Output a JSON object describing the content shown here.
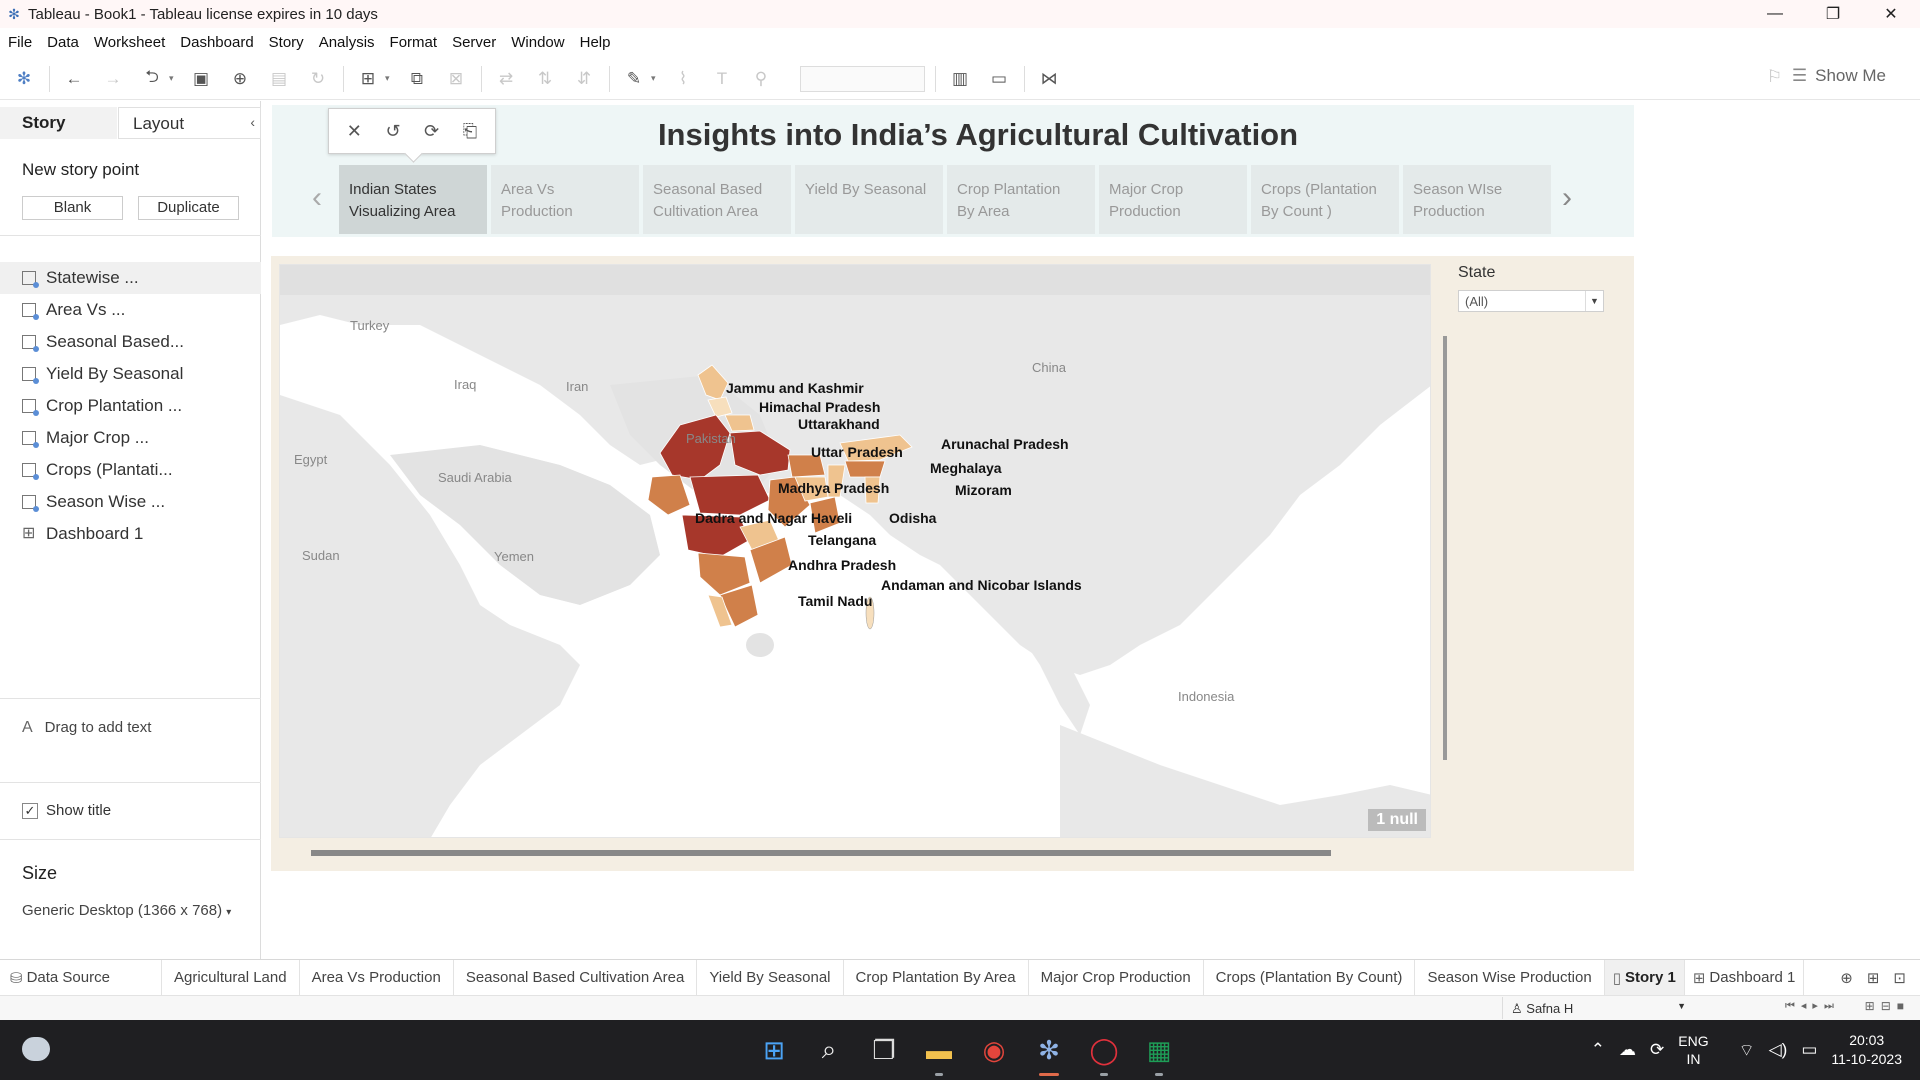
{
  "window": {
    "title": "Tableau - Book1 - Tableau license expires in 10 days",
    "minimize": "—",
    "restore": "❐",
    "close": "✕"
  },
  "menu": [
    "File",
    "Data",
    "Worksheet",
    "Dashboard",
    "Story",
    "Analysis",
    "Format",
    "Server",
    "Window",
    "Help"
  ],
  "toolbar": {
    "show_me": "Show Me"
  },
  "left_panel": {
    "tab_story": "Story",
    "tab_layout": "Layout",
    "new_story_point": "New story point",
    "blank": "Blank",
    "duplicate": "Duplicate",
    "sheets": [
      {
        "label": "Statewise ...",
        "kind": "sheet"
      },
      {
        "label": "Area Vs ...",
        "kind": "sheet"
      },
      {
        "label": "Seasonal Based...",
        "kind": "sheet"
      },
      {
        "label": "Yield By Seasonal",
        "kind": "sheet"
      },
      {
        "label": "Crop Plantation ...",
        "kind": "sheet"
      },
      {
        "label": "Major Crop ...",
        "kind": "sheet"
      },
      {
        "label": "Crops (Plantati...",
        "kind": "sheet"
      },
      {
        "label": "Season Wise ...",
        "kind": "sheet"
      },
      {
        "label": "Dashboard 1",
        "kind": "dashboard"
      }
    ],
    "drag_text": "Drag to add text",
    "show_title": "Show title",
    "size_label": "Size",
    "size_value": "Generic Desktop (1366 x 768)"
  },
  "story": {
    "title": "Insights into India’s Agricultural Cultivation",
    "points": [
      {
        "line1": "Indian States",
        "line2": "Visualizing Area",
        "active": true
      },
      {
        "line1": "Area Vs",
        "line2": "Production",
        "active": false
      },
      {
        "line1": "Seasonal Based",
        "line2": "Cultivation Area",
        "active": false
      },
      {
        "line1": "Yield By Seasonal",
        "line2": "",
        "active": false
      },
      {
        "line1": "Crop Plantation",
        "line2": "By Area",
        "active": false
      },
      {
        "line1": "Major Crop",
        "line2": "Production",
        "active": false
      },
      {
        "line1": "Crops (Plantation",
        "line2": "By Count )",
        "active": false
      },
      {
        "line1": "Season WIse",
        "line2": "Production",
        "active": false
      }
    ]
  },
  "map": {
    "countries": [
      "Turkey",
      "Iraq",
      "Iran",
      "Egypt",
      "Saudi Arabia",
      "Sudan",
      "Yemen",
      "Pakistan",
      "China",
      "Indonesia"
    ],
    "states": [
      "Jammu and Kashmir",
      "Himachal Pradesh",
      "Uttarakhand",
      "Uttar Pradesh",
      "Arunachal Pradesh",
      "Meghalaya",
      "Madhya Pradesh",
      "Mizoram",
      "Dadra and Nagar Haveli",
      "Odisha",
      "Telangana",
      "Andhra Pradesh",
      "Andaman and Nicobar Islands",
      "Tamil Nadu"
    ],
    "null_badge": "1 null",
    "colors": {
      "high": "#a7372b",
      "mid": "#d0804a",
      "low": "#efc38f",
      "lowest": "#f7dfbd",
      "land": "#e6e6e6",
      "water": "#ffffff"
    }
  },
  "filter": {
    "label": "State",
    "value": "(All)"
  },
  "sheet_tabs": [
    "Data Source",
    "Agricultural Land",
    "Area Vs Production",
    "Seasonal Based Cultivation Area",
    "Yield By Seasonal",
    "Crop Plantation By Area",
    "Major Crop Production",
    "Crops (Plantation By Count)",
    "Season Wise Production",
    "Story 1",
    "Dashboard 1"
  ],
  "status": {
    "user": "Safna H"
  },
  "taskbar": {
    "lang1": "ENG",
    "lang2": "IN",
    "time": "20:03",
    "date": "11-10-2023"
  }
}
